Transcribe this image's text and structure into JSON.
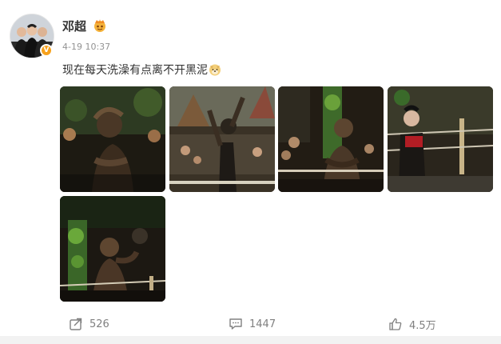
{
  "post": {
    "username": "邓超",
    "timestamp": "4-19 10:37",
    "text": "现在每天洗澡有点离不开黑泥",
    "emoji": "doge-icon"
  },
  "images": [
    {
      "name": "photo-1"
    },
    {
      "name": "photo-2"
    },
    {
      "name": "photo-3"
    },
    {
      "name": "photo-4"
    },
    {
      "name": "photo-5"
    }
  ],
  "actions": {
    "repost_count": "526",
    "comment_count": "1447",
    "like_count": "4.5万"
  },
  "colors": {
    "accent": "#f7a11b",
    "muted_text": "#939393",
    "text": "#333333"
  }
}
